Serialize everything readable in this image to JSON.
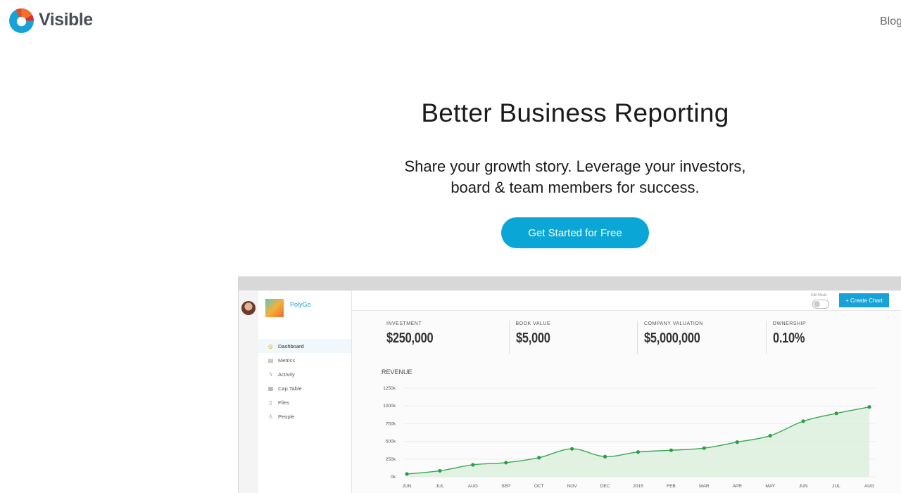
{
  "header": {
    "logo_text": "Visible",
    "nav": {
      "blog": "Blog"
    }
  },
  "hero": {
    "title": "Better Business Reporting",
    "subtitle_line1": "Share your growth story. Leverage your investors,",
    "subtitle_line2": "board & team members for success.",
    "cta_label": "Get Started for Free"
  },
  "app": {
    "company_name": "PolyGo",
    "nav": [
      {
        "label": "Dashboard",
        "icon": "dashboard-icon",
        "active": true
      },
      {
        "label": "Metrics",
        "icon": "metrics-icon",
        "active": false
      },
      {
        "label": "Activity",
        "icon": "activity-icon",
        "active": false
      },
      {
        "label": "Cap Table",
        "icon": "cap-table-icon",
        "active": false
      },
      {
        "label": "Files",
        "icon": "files-icon",
        "active": false
      },
      {
        "label": "People",
        "icon": "people-icon",
        "active": false
      }
    ],
    "edit_mode_label": "Edit Mode",
    "create_chart_label": "+ Create Chart",
    "kpis": [
      {
        "label": "INVESTMENT",
        "value": "$250,000"
      },
      {
        "label": "BOOK VALUE",
        "value": "$5,000"
      },
      {
        "label": "COMPANY VALUATION",
        "value": "$5,000,000"
      },
      {
        "label": "OWNERSHIP",
        "value": "0.10%"
      }
    ],
    "revenue_title": "REVENUE"
  },
  "chart_data": {
    "type": "area",
    "title": "REVENUE",
    "xlabel": "",
    "ylabel": "",
    "categories": [
      "JUN",
      "JUL",
      "AUG",
      "SEP",
      "OCT",
      "NOV",
      "DEC",
      "2015",
      "FEB",
      "MAR",
      "APR",
      "MAY",
      "JUN",
      "JUL",
      "AUG"
    ],
    "y_ticks": [
      "0k",
      "250k",
      "500k",
      "750k",
      "1000k",
      "1250k"
    ],
    "ylim": [
      0,
      1250
    ],
    "series": [
      {
        "values": [
          40,
          85,
          170,
          200,
          270,
          395,
          285,
          350,
          375,
          405,
          490,
          580,
          785,
          895,
          985
        ]
      }
    ],
    "grid": true,
    "colors": {
      "line": "#3aa655",
      "fill": "#d8efd9",
      "point": "#2f9a47"
    }
  },
  "colors": {
    "cta": "#0aa6d6",
    "create_chart": "#18a2d8",
    "link": "#1aa0d0"
  }
}
